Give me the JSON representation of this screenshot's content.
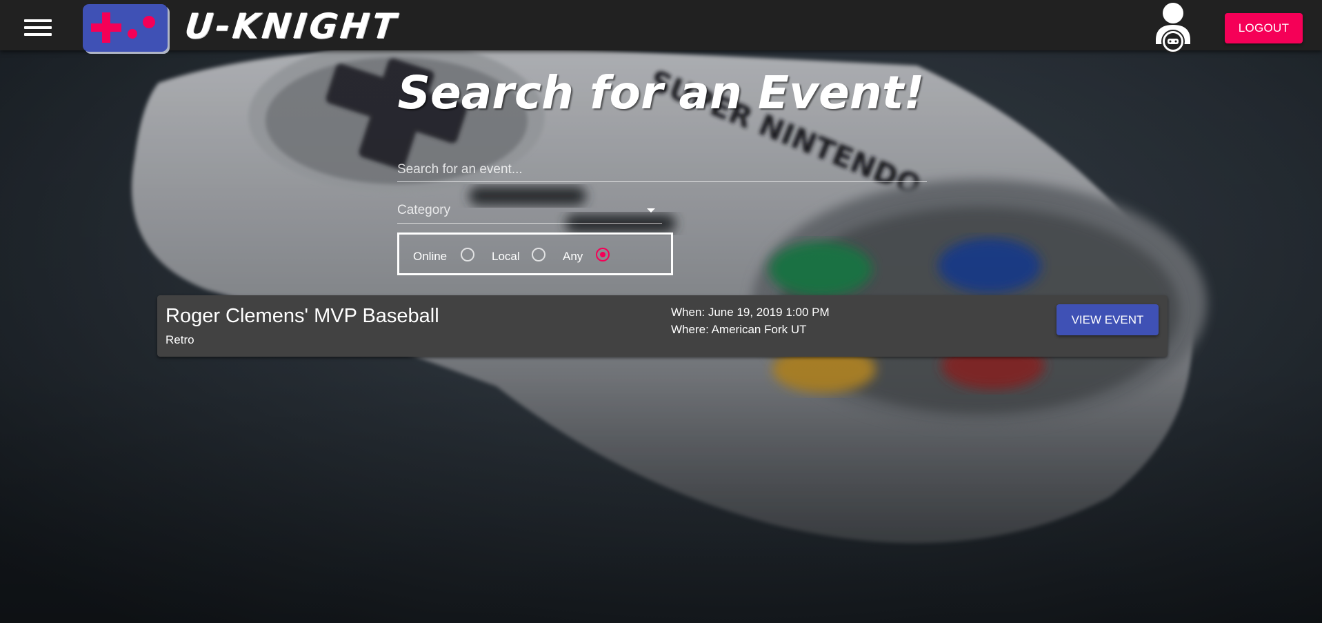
{
  "appbar": {
    "brand": "U-KNIGHT",
    "logout_label": "LOGOUT"
  },
  "page": {
    "title": "Search for an Event!"
  },
  "search": {
    "placeholder": "Search for an event...",
    "value": ""
  },
  "category": {
    "label": "Category"
  },
  "location_filter": {
    "options": [
      {
        "label": "Online",
        "selected": false
      },
      {
        "label": "Local",
        "selected": false
      },
      {
        "label": "Any",
        "selected": true
      }
    ]
  },
  "events": [
    {
      "title": "Roger Clemens' MVP Baseball",
      "category": "Retro",
      "when": "When: June 19, 2019 1:00 PM",
      "where": "Where: American Fork UT",
      "action_label": "VIEW EVENT"
    }
  ],
  "background": {
    "subject": "gamepad-photo",
    "controller_text": "SUPER NINTENDO"
  },
  "colors": {
    "appbar": "#212121",
    "primary": "#3f51b5",
    "accent": "#f50057",
    "card": "#424242"
  }
}
